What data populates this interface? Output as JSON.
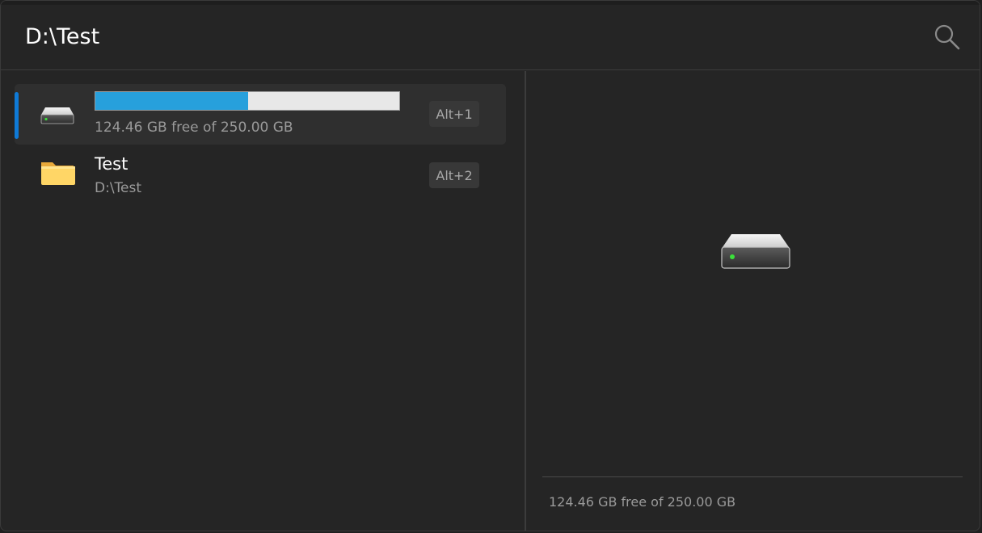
{
  "search": {
    "value": "D:\\Test",
    "icon": "search-icon"
  },
  "results": [
    {
      "type": "drive",
      "icon": "drive-icon",
      "usage_fraction": 0.502,
      "subtitle": "124.46 GB free of 250.00 GB",
      "shortcut": "Alt+1",
      "selected": true
    },
    {
      "type": "folder",
      "icon": "folder-icon",
      "title": "Test",
      "subtitle": "D:\\Test",
      "shortcut": "Alt+2",
      "selected": false
    }
  ],
  "preview": {
    "icon": "drive-icon",
    "info": "124.46 GB free of 250.00 GB"
  },
  "colors": {
    "accent": "#0f7ad6",
    "usage_fill": "#27a0dc",
    "background": "#252525"
  }
}
